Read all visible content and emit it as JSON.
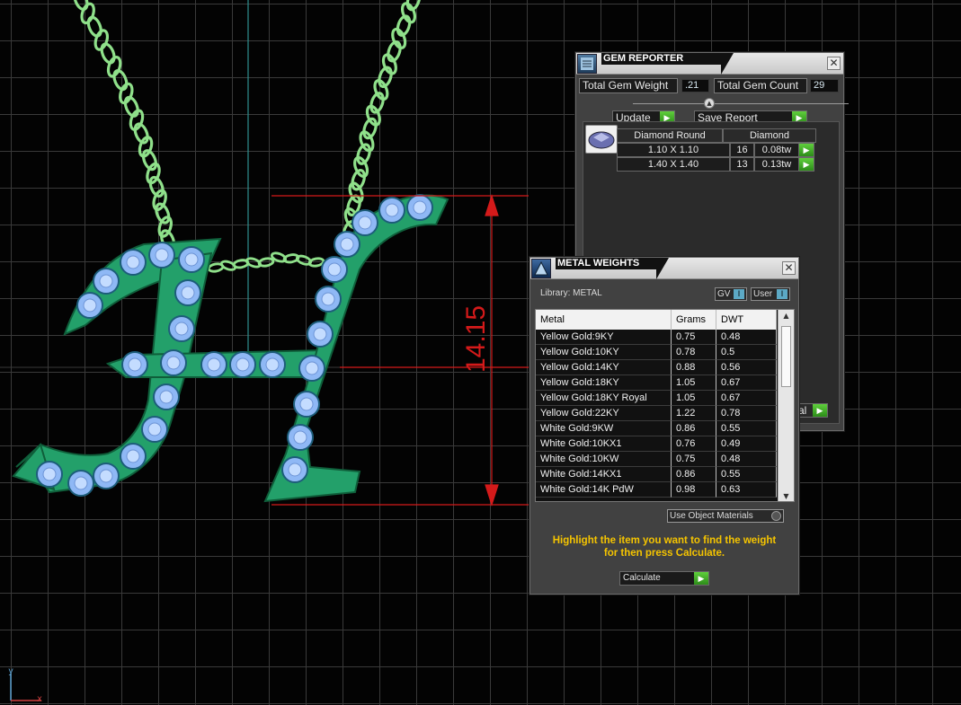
{
  "viewport": {
    "dimension_value": "14.15",
    "axis_y": "y",
    "axis_x": "x",
    "colors": {
      "background": "#030303",
      "grid": "#3a3a3a",
      "dimension": "#d41a1a",
      "chain": "#8fe08a",
      "metal": "#23a06a",
      "gem": "#9dc6ff"
    }
  },
  "gem_reporter": {
    "title": "GEM REPORTER",
    "close": "✕",
    "total_gem_weight_label": "Total Gem Weight",
    "total_gem_weight_value": ".21",
    "total_gem_count_label": "Total Gem Count",
    "total_gem_count_value": "29",
    "collapse_icon": "chevron-up-icon",
    "update_label": "Update",
    "save_report_label": "Save Report",
    "go_arrow": "▶",
    "partial_button_label": "al",
    "table": {
      "header_shape": "Diamond Round",
      "header_material": "Diamond",
      "rows": [
        {
          "size": "1.10 X 1.10",
          "count": "16",
          "weight": "0.08tw"
        },
        {
          "size": "1.40 X 1.40",
          "count": "13",
          "weight": "0.13tw"
        }
      ]
    }
  },
  "metal_weights": {
    "title": "METAL WEIGHTS",
    "close": "✕",
    "library_label": "Library: METAL",
    "gv_label": "GV",
    "user_label": "User",
    "toggle_glyph": "I",
    "columns": [
      "Metal",
      "Grams",
      "DWT"
    ],
    "rows": [
      {
        "metal": "Yellow Gold:9KY",
        "grams": "0.75",
        "dwt": "0.48"
      },
      {
        "metal": "Yellow Gold:10KY",
        "grams": "0.78",
        "dwt": "0.5"
      },
      {
        "metal": "Yellow Gold:14KY",
        "grams": "0.88",
        "dwt": "0.56"
      },
      {
        "metal": "Yellow Gold:18KY",
        "grams": "1.05",
        "dwt": "0.67"
      },
      {
        "metal": "Yellow Gold:18KY Royal",
        "grams": "1.05",
        "dwt": "0.67"
      },
      {
        "metal": "Yellow Gold:22KY",
        "grams": "1.22",
        "dwt": "0.78"
      },
      {
        "metal": "White Gold:9KW",
        "grams": "0.86",
        "dwt": "0.55"
      },
      {
        "metal": "White Gold:10KX1",
        "grams": "0.76",
        "dwt": "0.49"
      },
      {
        "metal": "White Gold:10KW",
        "grams": "0.75",
        "dwt": "0.48"
      },
      {
        "metal": "White Gold:14KX1",
        "grams": "0.86",
        "dwt": "0.55"
      },
      {
        "metal": "White Gold:14K PdW",
        "grams": "0.98",
        "dwt": "0.63"
      }
    ],
    "use_object_materials_label": "Use Object Materials",
    "message_line1": "Highlight the item you want to find the weight",
    "message_line2": "for then press Calculate.",
    "calculate_label": "Calculate",
    "scroll_up": "▲",
    "scroll_down": "▼"
  }
}
